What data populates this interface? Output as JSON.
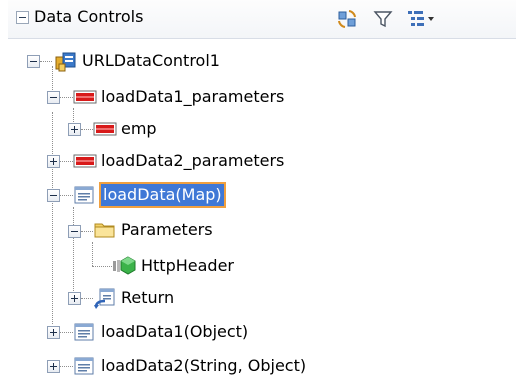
{
  "header": {
    "title": "Data Controls",
    "toolbar": {
      "refresh_icon": "refresh-icon",
      "filter_icon": "filter-icon",
      "options_icon": "tree-options-icon"
    }
  },
  "tree": {
    "nodes": [
      {
        "label": "URLDataControl1",
        "icon": "datacontrol-icon",
        "state": "expanded"
      },
      {
        "label": "loadData1_parameters",
        "icon": "struct-icon",
        "state": "expanded"
      },
      {
        "label": "emp",
        "icon": "struct-icon",
        "state": "collapsed"
      },
      {
        "label": "loadData2_parameters",
        "icon": "struct-icon",
        "state": "collapsed"
      },
      {
        "label": "loadData(Map)",
        "icon": "method-icon",
        "state": "expanded",
        "selected": true
      },
      {
        "label": "Parameters",
        "icon": "folder-icon",
        "state": "expanded"
      },
      {
        "label": "HttpHeader",
        "icon": "parameter-icon",
        "state": "leaf"
      },
      {
        "label": "Return",
        "icon": "return-icon",
        "state": "collapsed"
      },
      {
        "label": "loadData1(Object)",
        "icon": "method-icon",
        "state": "collapsed"
      },
      {
        "label": "loadData2(String, Object)",
        "icon": "method-icon",
        "state": "collapsed"
      }
    ]
  },
  "colors": {
    "selection_bg": "#3f78d6",
    "selection_border": "#f0a040",
    "struct_red": "#d81a1a",
    "folder_yellow": "#f3d36a",
    "param_green": "#3cb34a"
  }
}
